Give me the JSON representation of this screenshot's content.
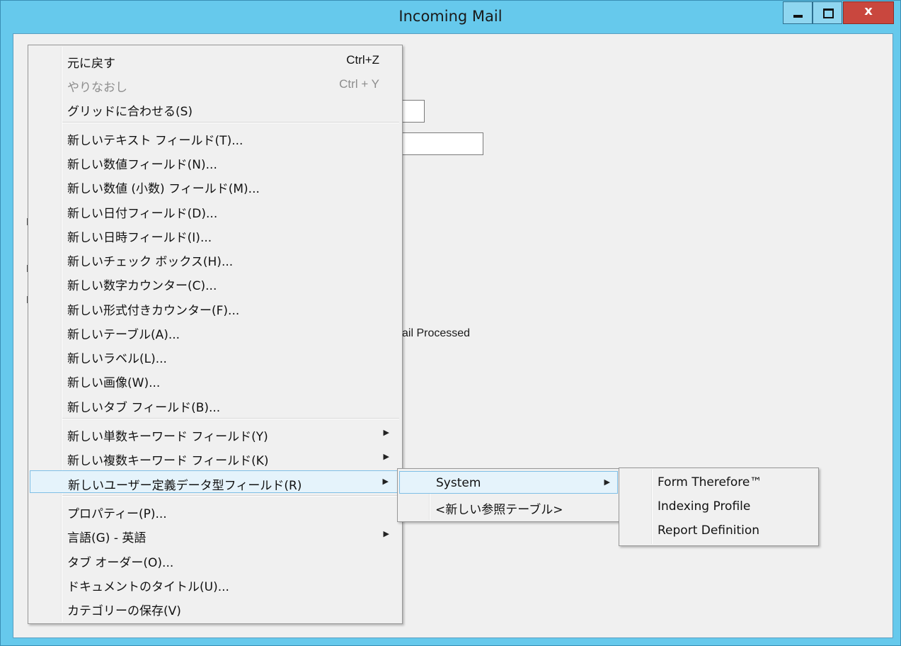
{
  "window": {
    "title": "Incoming Mail",
    "close_glyph": "x",
    "icons": {
      "minimize": "minimize-icon",
      "maximize": "maximize-icon",
      "close": "close-icon"
    }
  },
  "background": {
    "partial_label": "ail Processed"
  },
  "context_menu": {
    "items": [
      {
        "label": "元に戻す",
        "shortcut": "Ctrl+Z"
      },
      {
        "label": "やりなおし",
        "shortcut": "Ctrl + Y",
        "disabled": true
      },
      {
        "label": "グリッドに合わせる(S)"
      },
      {
        "label": "新しいテキスト フィールド(T)..."
      },
      {
        "label": "新しい数値フィールド(N)..."
      },
      {
        "label": "新しい数値 (小数) フィールド(M)..."
      },
      {
        "label": "新しい日付フィールド(D)..."
      },
      {
        "label": "新しい日時フィールド(I)..."
      },
      {
        "label": "新しいチェック ボックス(H)..."
      },
      {
        "label": "新しい数字カウンター(C)..."
      },
      {
        "label": "新しい形式付きカウンター(F)..."
      },
      {
        "label": "新しいテーブル(A)..."
      },
      {
        "label": "新しいラベル(L)..."
      },
      {
        "label": "新しい画像(W)..."
      },
      {
        "label": "新しいタブ フィールド(B)..."
      },
      {
        "label": "新しい単数キーワード フィールド(Y)",
        "submenu": true
      },
      {
        "label": "新しい複数キーワード フィールド(K)",
        "submenu": true
      },
      {
        "label": "新しいユーザー定義データ型フィールド(R)",
        "submenu": true,
        "highlighted": true
      },
      {
        "label": "プロパティー(P)..."
      },
      {
        "label": "言語(G) - 英語",
        "submenu": true
      },
      {
        "label": "タブ オーダー(O)..."
      },
      {
        "label": "ドキュメントのタイトル(U)..."
      },
      {
        "label": "カテゴリーの保存(V)"
      }
    ]
  },
  "submenu_1": {
    "items": [
      {
        "label": "System",
        "submenu": true,
        "highlighted": true
      },
      {
        "label": "<新しい参照テーブル>"
      }
    ]
  },
  "submenu_2": {
    "items": [
      {
        "label": "Form Therefore™"
      },
      {
        "label": "Indexing Profile"
      },
      {
        "label": "Report Definition"
      }
    ]
  },
  "glyphs": {
    "submenu_arrow": "▶"
  }
}
